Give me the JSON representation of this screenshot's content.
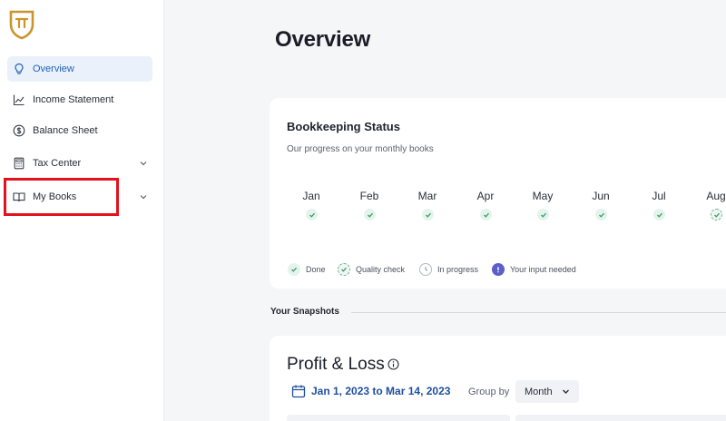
{
  "sidebar": {
    "items": [
      {
        "label": "Overview",
        "icon": "lightbulb-icon",
        "active": true
      },
      {
        "label": "Income Statement",
        "icon": "line-chart-icon"
      },
      {
        "label": "Balance Sheet",
        "icon": "dollar-circle-icon"
      },
      {
        "label": "Tax Center",
        "icon": "calculator-icon",
        "expandable": true
      },
      {
        "label": "My Books",
        "icon": "open-book-icon",
        "expandable": true
      }
    ]
  },
  "page": {
    "title": "Overview"
  },
  "bookkeeping": {
    "title": "Bookkeeping Status",
    "subtitle": "Our progress on your monthly books",
    "months": [
      {
        "label": "Jan",
        "status": "done"
      },
      {
        "label": "Feb",
        "status": "done"
      },
      {
        "label": "Mar",
        "status": "done"
      },
      {
        "label": "Apr",
        "status": "done"
      },
      {
        "label": "May",
        "status": "done"
      },
      {
        "label": "Jun",
        "status": "done"
      },
      {
        "label": "Jul",
        "status": "done"
      },
      {
        "label": "Aug",
        "status": "quality-check"
      }
    ],
    "legend": {
      "done": "Done",
      "quality_check": "Quality check",
      "in_progress": "In progress",
      "input_needed": "Your input needed"
    }
  },
  "snapshots": {
    "title": "Your Snapshots"
  },
  "profit_loss": {
    "title": "Profit & Loss",
    "date_range": "Jan 1, 2023 to Mar 14, 2023",
    "group_by_label": "Group by",
    "group_by_value": "Month"
  },
  "colors": {
    "accent": "#1f63b8",
    "brand_gold": "#c9962b",
    "done_green": "#3a9d6a",
    "input_needed_purple": "#5b5fc7",
    "highlight_red": "#e4111c"
  }
}
